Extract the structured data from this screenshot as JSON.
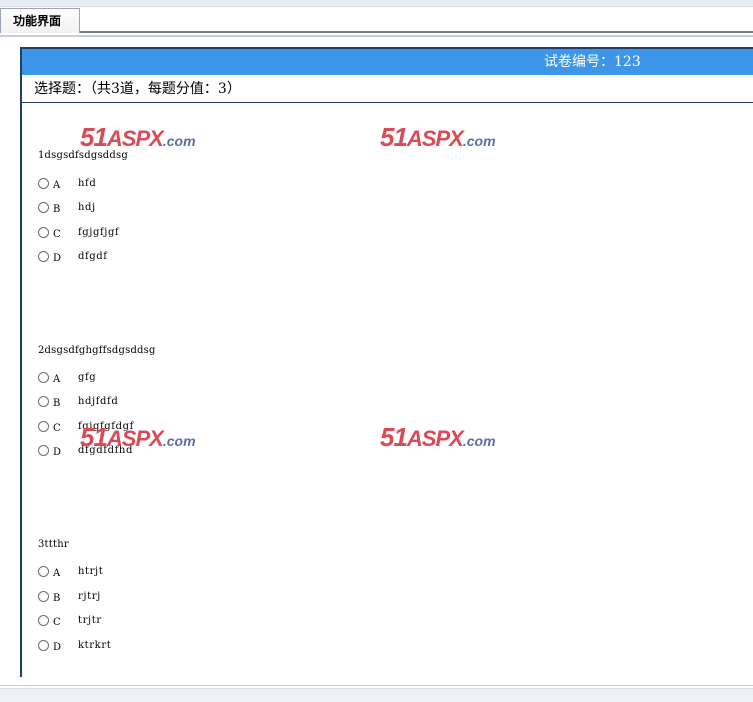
{
  "tab": {
    "label": "功能界面"
  },
  "header": {
    "exam_number": "试卷编号：123"
  },
  "section": {
    "label": "选择题：（共3道，每题分值：3）"
  },
  "questions": [
    {
      "title": "1dsgsdfsdgsddsg",
      "options": [
        {
          "letter": "A",
          "text": "hfd"
        },
        {
          "letter": "B",
          "text": "hdj"
        },
        {
          "letter": "C",
          "text": "fgjgfjgf"
        },
        {
          "letter": "D",
          "text": "dfgdf"
        }
      ]
    },
    {
      "title": "2dsgsdfghgffsdgsddsg",
      "options": [
        {
          "letter": "A",
          "text": "gfg"
        },
        {
          "letter": "B",
          "text": "hdjfdfd"
        },
        {
          "letter": "C",
          "text": "fgjgfgfdgf"
        },
        {
          "letter": "D",
          "text": "dfgdfdfhd"
        }
      ]
    },
    {
      "title": "3ttthr",
      "options": [
        {
          "letter": "A",
          "text": "htrjt"
        },
        {
          "letter": "B",
          "text": "rjtrj"
        },
        {
          "letter": "C",
          "text": "trjtr"
        },
        {
          "letter": "D",
          "text": "ktrkrt"
        }
      ]
    }
  ],
  "watermark": {
    "part1": "51",
    "part2": "ASPX",
    "part3": ".com"
  }
}
